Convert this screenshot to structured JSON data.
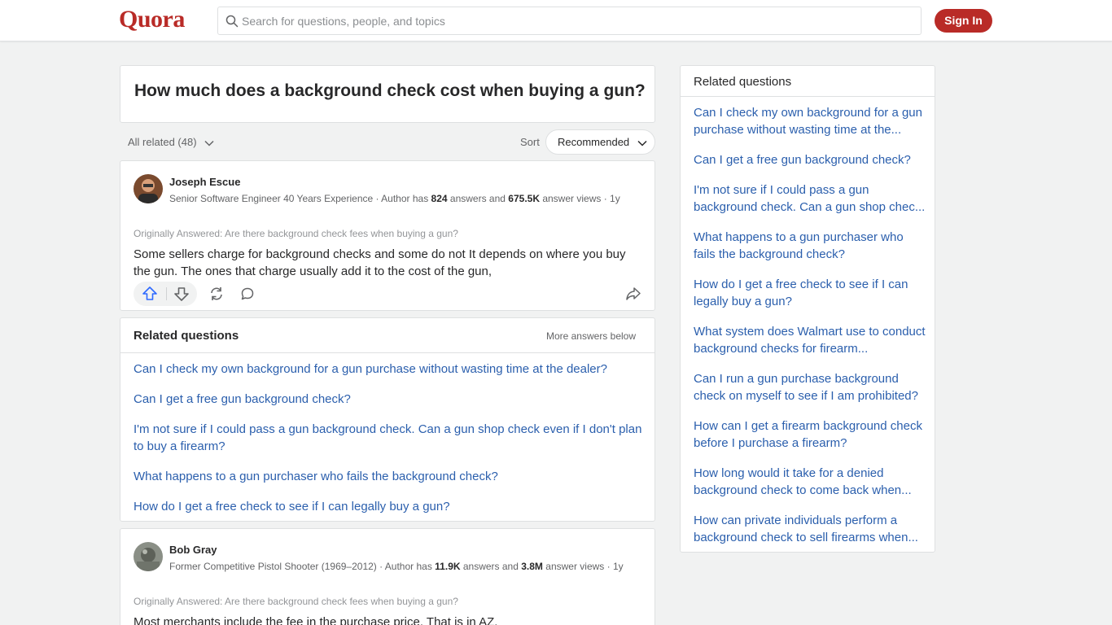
{
  "header": {
    "logo": "Quora",
    "search_placeholder": "Search for questions, people, and topics",
    "signin_label": "Sign In"
  },
  "question": {
    "title": "How much does a background check cost when buying a gun?"
  },
  "filters": {
    "all_related": "All related (48)",
    "sort_label": "Sort",
    "sort_value": "Recommended"
  },
  "answers": [
    {
      "name": "Joseph Escue",
      "credential_prefix": "Senior Software Engineer 40 Years Experience · Author has ",
      "answers_count": "824",
      "answers_mid": " answers and ",
      "views_count": "675.5K",
      "views_suffix": " answer views · 1y",
      "originally_answered": "Originally Answered: Are there background check fees when buying a gun?",
      "body": "Some sellers charge for background checks and some do not It depends on where you buy the gun. The ones that charge usually add it to the cost of the gun,"
    },
    {
      "name": "Bob Gray",
      "credential_prefix": "Former Competitive Pistol Shooter (1969–2012) · Author has ",
      "answers_count": "11.9K",
      "answers_mid": " answers and ",
      "views_count": "3.8M",
      "views_suffix": " answer views · 1y",
      "originally_answered": "Originally Answered: Are there background check fees when buying a gun?",
      "body": "Most merchants include the fee in the purchase price. That is in AZ."
    }
  ],
  "related_inline": {
    "title": "Related questions",
    "more_label": "More answers below",
    "items": [
      "Can I check my own background for a gun purchase without wasting time at the dealer?",
      "Can I get a free gun background check?",
      "I'm not sure if I could pass a gun background check. Can a gun shop check even if I don't plan to buy a firearm?",
      "What happens to a gun purchaser who fails the background check?",
      "How do I get a free check to see if I can legally buy a gun?"
    ]
  },
  "sidebar": {
    "title": "Related questions",
    "items": [
      "Can I check my own background for a gun purchase without wasting time at the...",
      "Can I get a free gun background check?",
      "I'm not sure if I could pass a gun background check. Can a gun shop chec...",
      "What happens to a gun purchaser who fails the background check?",
      "How do I get a free check to see if I can legally buy a gun?",
      "What system does Walmart use to conduct background checks for firearm...",
      "Can I run a gun purchase background check on myself to see if I am prohibited?",
      "How can I get a firearm background check before I purchase a firearm?",
      "How long would it take for a denied background check to come back when...",
      "How can private individuals perform a background check to sell firearms when..."
    ]
  },
  "icons": {
    "search": "search-icon",
    "upvote": "upvote-icon",
    "downvote": "downvote-icon",
    "share": "reshare-icon",
    "comment": "comment-icon",
    "forward": "share-icon"
  },
  "colors": {
    "brand": "#b92b27",
    "link": "#2b5fad",
    "upvote": "#2e69ff"
  }
}
